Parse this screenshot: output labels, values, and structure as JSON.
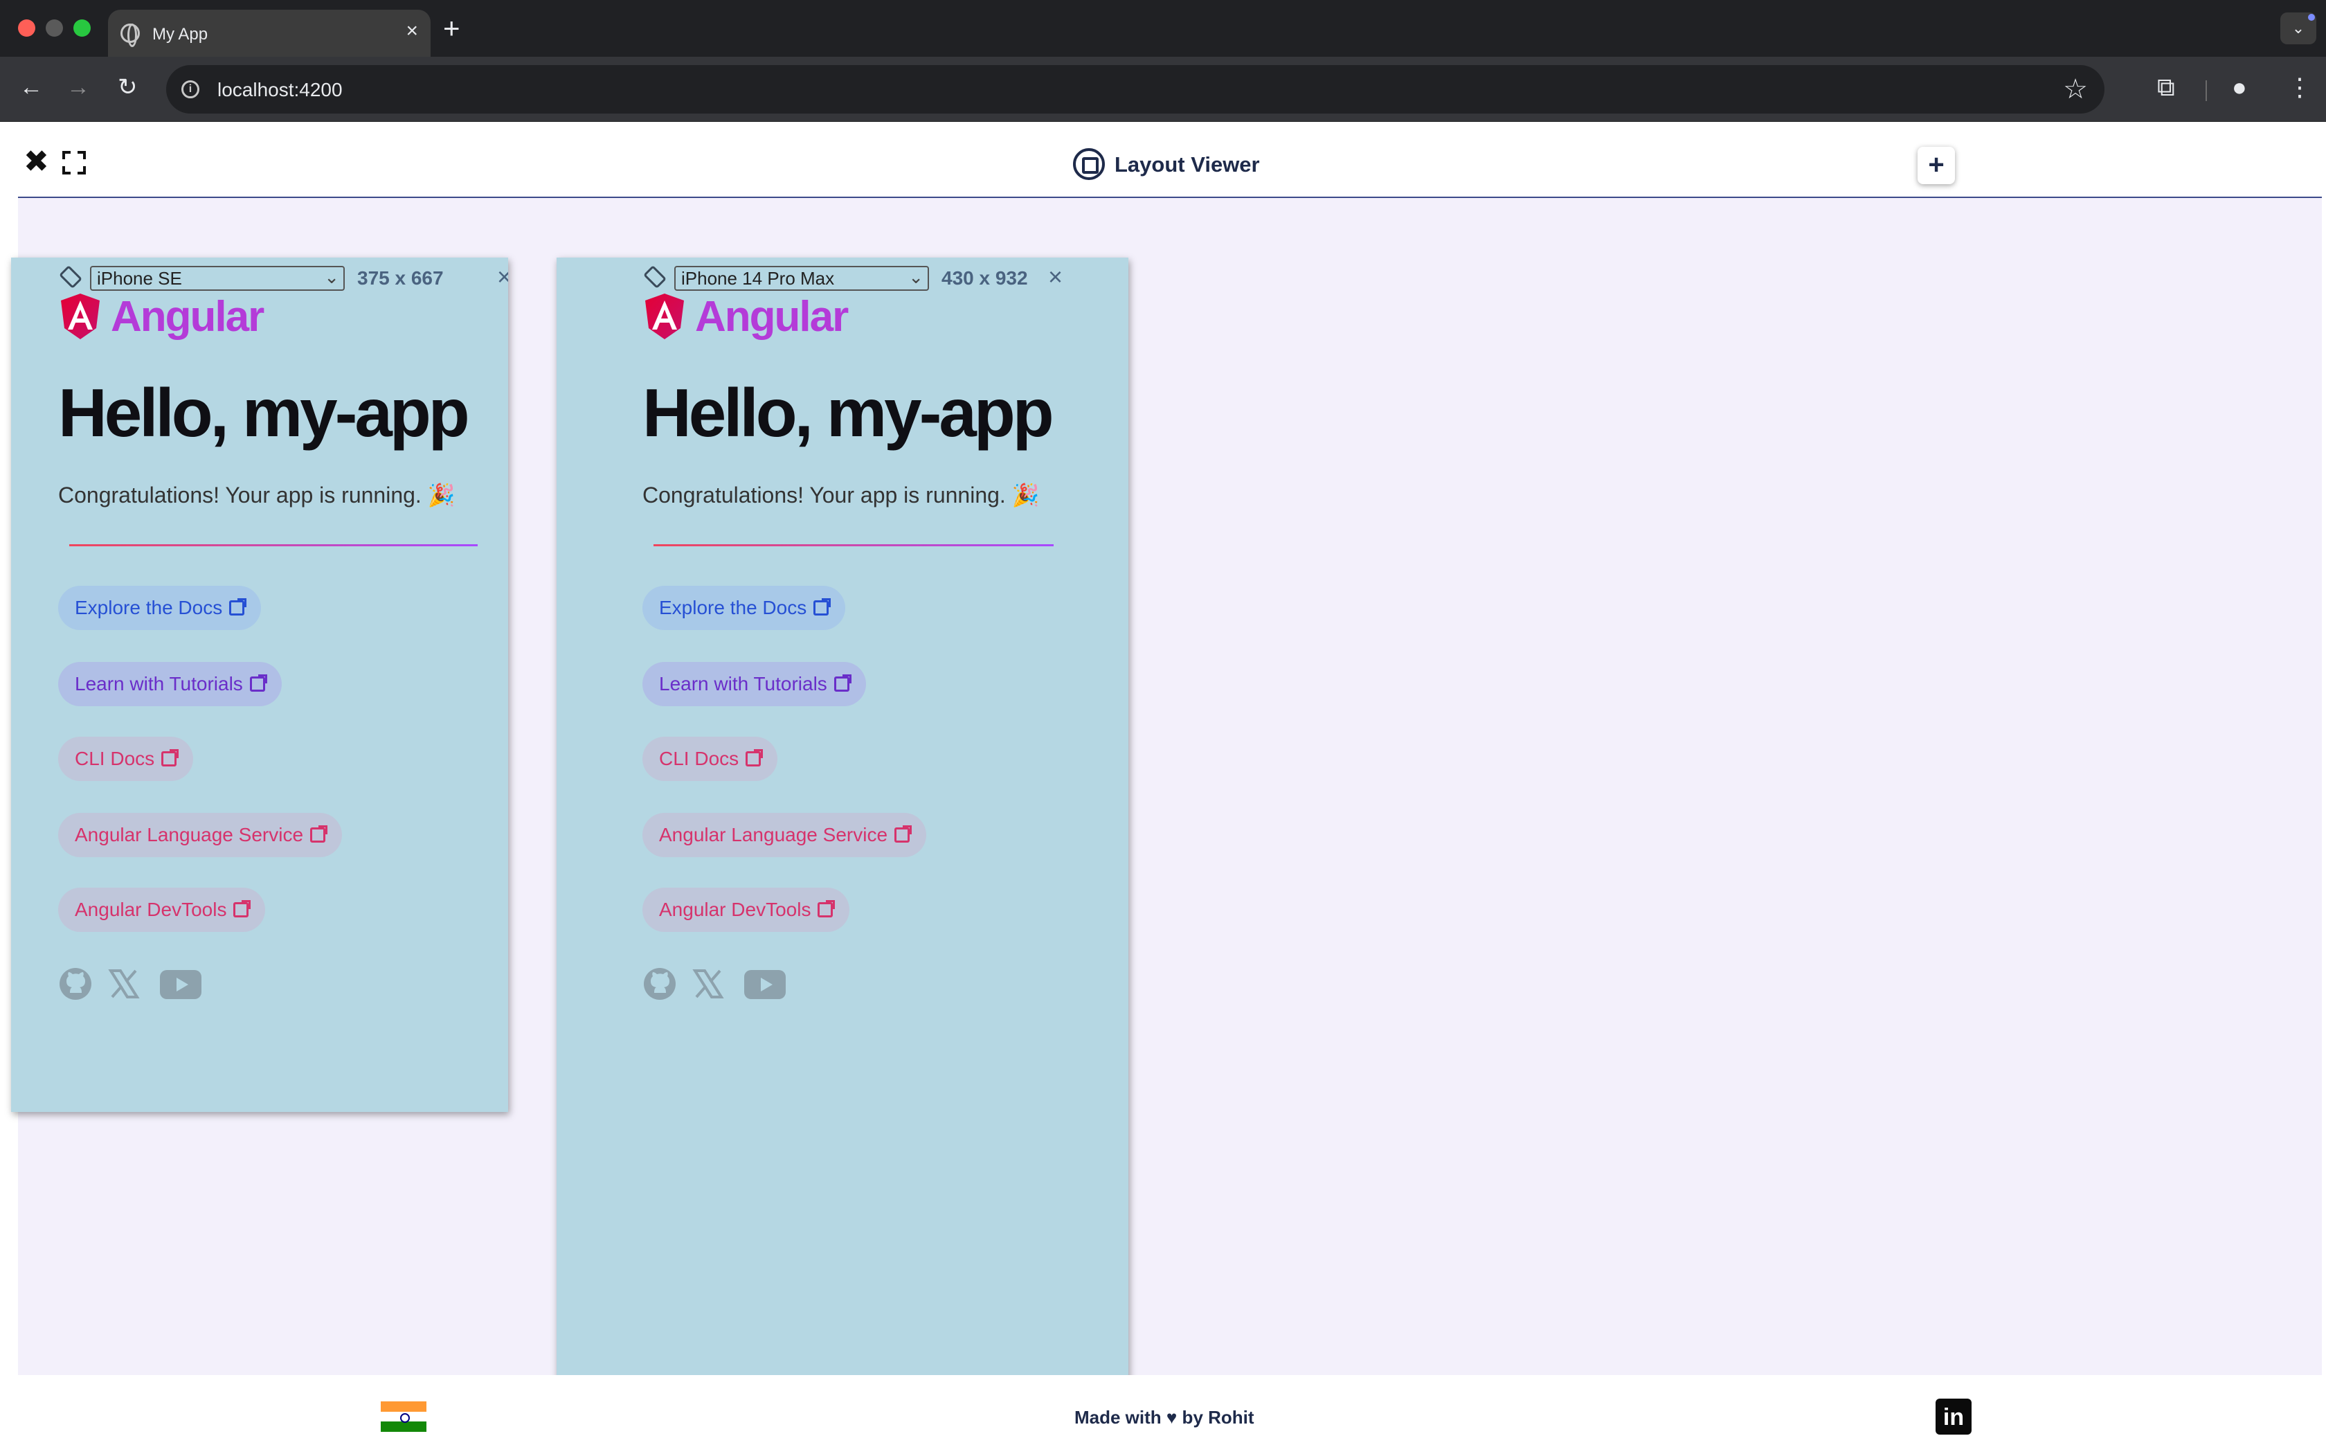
{
  "browser": {
    "tab_title": "My App",
    "tab_close": "×",
    "new_tab": "+",
    "url": "localhost:4200",
    "tab_search": "⌄"
  },
  "header": {
    "close_symbol": "✖",
    "title": "Layout Viewer",
    "add_symbol": "+"
  },
  "devices": [
    {
      "model": "iPhone SE",
      "size": "375 x 667",
      "close": "×"
    },
    {
      "model": "iPhone 14 Pro Max",
      "size": "430 x 932",
      "close": "×"
    }
  ],
  "app": {
    "logo_text": "Angular",
    "heading": "Hello, my-app",
    "subtitle": "Congratulations! Your app is running. 🎉",
    "links": [
      "Explore the Docs",
      "Learn with Tutorials",
      "CLI Docs",
      "Angular Language Service",
      "Angular DevTools"
    ],
    "socials": [
      "github-icon",
      "x-icon",
      "youtube-icon"
    ]
  },
  "footer": {
    "made_with": "Made with ♥ by Rohit",
    "linkedin": "in"
  },
  "colors": {
    "accent": "#1e2a4a",
    "device_bg": "#b5d7e3",
    "canvas_bg": "#f3f0fb",
    "link_blue": "#2650d4",
    "link_purple": "#6a2ec9",
    "link_pink": "#d6336c"
  }
}
